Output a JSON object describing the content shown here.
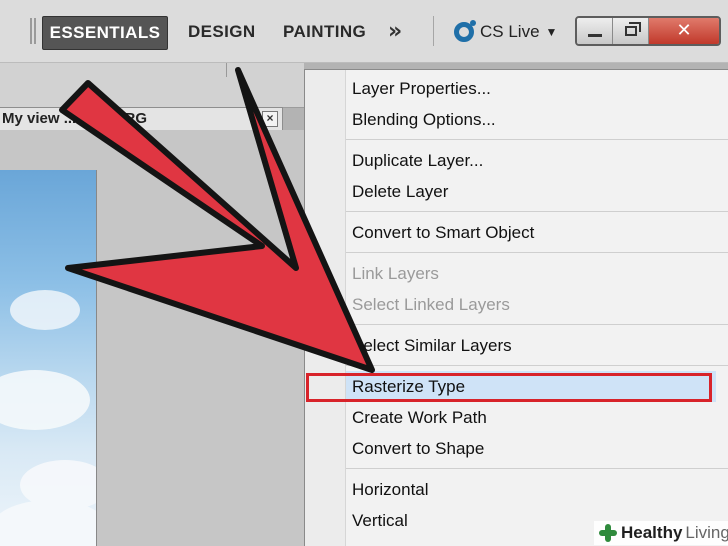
{
  "workspace_bar": {
    "essentials": "ESSENTIALS",
    "design": "DESIGN",
    "painting": "PAINTING",
    "more": "»",
    "cs_live": "CS Live"
  },
  "document_tab": {
    "title": "My view ... ning , RG",
    "close": "×"
  },
  "context_menu": {
    "groups": [
      [
        {
          "label": "Layer Properties...",
          "enabled": true
        },
        {
          "label": "Blending Options...",
          "enabled": true
        }
      ],
      [
        {
          "label": "Duplicate Layer...",
          "enabled": true
        },
        {
          "label": "Delete Layer",
          "enabled": true
        }
      ],
      [
        {
          "label": "Convert to Smart Object",
          "enabled": true
        }
      ],
      [
        {
          "label": "Link Layers",
          "enabled": false
        },
        {
          "label": "Select Linked Layers",
          "enabled": false
        }
      ],
      [
        {
          "label": "Select Similar Layers",
          "enabled": true
        }
      ],
      [
        {
          "label": "Rasterize Type",
          "enabled": true,
          "highlighted": true
        },
        {
          "label": "Create Work Path",
          "enabled": true
        },
        {
          "label": "Convert to Shape",
          "enabled": true
        }
      ],
      [
        {
          "label": "Horizontal",
          "enabled": true
        },
        {
          "label": "Vertical",
          "enabled": true
        }
      ]
    ]
  },
  "annotation": {
    "arrow_color": "#e03642",
    "highlight_color": "#d8232a"
  },
  "brand": {
    "part1": "Healthy",
    "part2": "Living"
  }
}
